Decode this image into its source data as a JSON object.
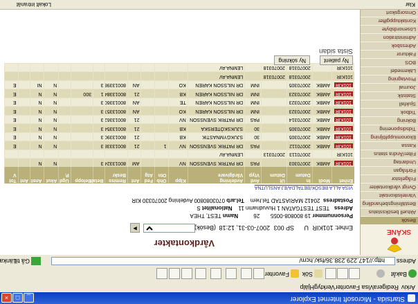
{
  "window": {
    "title": "Startsida - Microsoft Internet Explorer",
    "minimize": "_",
    "maximize": "□",
    "close": "×"
  },
  "menu": [
    "Arkiv",
    "Redigera",
    "Visa",
    "Favoriter",
    "Verktyg",
    "Hjälp"
  ],
  "toolbar": {
    "back": "Bakåt",
    "search": "Sök",
    "favorites": "Favoriter"
  },
  "address": {
    "label": "Adress",
    "url": "http://147.229.238.36/fsk/.hcm/",
    "go": "Gå till",
    "links": "Länkar"
  },
  "status": {
    "done": "Klar",
    "zone": "Lokalt intranät"
  },
  "sidebar": {
    "logo_text": "SKÅNE",
    "items": [
      {
        "label": "Besök",
        "active": true
      },
      {
        "label": "Aktuell besöksstatus",
        "active": false
      },
      {
        "label": "Beställningsbehandling",
        "active": false
      },
      {
        "label": "Väntelistkontakt",
        "active": false
      },
      {
        "label": "Övrigt vårdkontakter",
        "active": false
      },
      {
        "label": "Frågelistor",
        "active": false
      },
      {
        "label": "Förfrågan",
        "active": false
      },
      {
        "label": "Undantag",
        "active": false
      },
      {
        "label": "Filter/Ändra status",
        "active": false
      },
      {
        "label": "Kassa",
        "active": false
      },
      {
        "label": "Ekonomiuppföljning",
        "active": false
      },
      {
        "label": "Tidsdisponering",
        "active": false
      },
      {
        "label": "Bokning",
        "active": false
      },
      {
        "label": "Tidbok",
        "active": false
      },
      {
        "label": "Sjukfall",
        "active": false
      },
      {
        "label": "Statistik",
        "active": false
      },
      {
        "label": "Journal",
        "active": false
      },
      {
        "label": "Provtagning",
        "active": false
      },
      {
        "label": "Läkemedel",
        "active": false
      },
      {
        "label": "BOS",
        "active": false
      },
      {
        "label": "Fakturor",
        "active": false
      },
      {
        "label": "Adressbok",
        "active": false
      },
      {
        "label": "Administration",
        "active": false
      },
      {
        "label": "Lösenordsbyte",
        "active": false
      },
      {
        "label": "Kontaktuppgifter",
        "active": false
      },
      {
        "label": "Omsorgskort",
        "active": false
      }
    ]
  },
  "main": {
    "title": "Vårdkontakter",
    "meta": {
      "enhet": "Enhet: 101KIR",
      "u": "U",
      "sp": "SP 003",
      "datetime": "2007-03-31, 12:18",
      "reason_label": "(Besök)",
      "reason_value": ""
    },
    "patient": {
      "pnr_label": "Personnummer",
      "pnr": "19 800808-0055",
      "age": "26",
      "name_label": "Namn",
      "name": "TEST, THEA",
      "addr_label": "Adress",
      "addr": "TEST TESTGATAN 1   Huvudnamn 11",
      "nat_label": "Nationalitet",
      "nat": "S",
      "post_label": "Postadress",
      "post": "20412 MARIASTAD Tel.hem",
      "tel_label": "Tel.arb",
      "tel": "0703080800 Avdelning 20070330 KIR"
    },
    "show_all_link": "VISA ALLA BESÖK/BETALDA/EJ ANSLUTNA",
    "tabs": [
      "Ny patient",
      "Ny sökning"
    ],
    "section": "Sista sidan",
    "table": {
      "headers": [
        "Enhet",
        "Modt",
        "In\nDatum",
        "Ut\nDatum",
        "Avd\nVtyp",
        "Avdelning\nVårdgivare",
        "Klpp",
        "Ohb\nOtn",
        "Fed\nAtg",
        "Ant",
        "Remiss\nBeskr",
        "Betalt",
        "Belopp",
        "Ugd\nP.",
        "Akut",
        "Anst",
        "Ant",
        "Tot\nV"
      ],
      "rows": [
        [
          "101KIR",
          "AMBK",
          "20070303",
          "",
          "PAS",
          "DR PATRIK SVENSSON",
          "NV",
          "",
          "",
          "AM",
          "80013324",
          "3",
          "",
          "",
          "N",
          "N",
          "",
          ""
        ],
        [
          "101KIR",
          "",
          "20070113",
          "20070313",
          "",
          "LEMNA AV",
          "",
          "",
          "",
          "",
          "",
          "",
          "",
          "",
          "",
          "",
          "",
          ""
        ],
        [
          "101KIR",
          "AMBK",
          "20070112",
          "",
          "PAS",
          "DR PATRIK SVENSSON",
          "NV",
          "1",
          "",
          "21",
          "80013338",
          "3",
          "",
          "",
          "N",
          "N",
          "",
          "E"
        ],
        [
          "101KIR",
          "AMBK",
          "20070305",
          "",
          "30",
          "SJUKGYMNASTIK",
          "KB",
          "",
          "",
          "21",
          "80013390",
          "3",
          "",
          "",
          "N",
          "N",
          "",
          "E"
        ],
        [
          "101KIR",
          "AMBK",
          "20070305",
          "",
          "30",
          "SJUKSKÖTERSKA",
          "KB",
          "",
          "",
          "21",
          "80013354",
          "3",
          "",
          "",
          "N",
          "N",
          "",
          "E"
        ],
        [
          "101KIR",
          "AMBK",
          "20070314",
          "",
          "PAS",
          "DR PATRIK SVENSSON",
          "NV",
          "",
          "",
          "21",
          "80013362",
          "3",
          "",
          "",
          "N",
          "N",
          "",
          "E"
        ],
        [
          "101KIR",
          "AMBK",
          "20070323",
          "",
          "INM",
          "DR NILSSON KAREN",
          "KO",
          "",
          "",
          "AN",
          "80013357",
          "3",
          "",
          "",
          "N",
          "N",
          "",
          "E"
        ],
        [
          "101KIR",
          "AMBK",
          "20070323",
          "",
          "INM",
          "DR NILSSON KAREN",
          "TE",
          "",
          "",
          "AN",
          "80013360",
          "3",
          "",
          "",
          "N",
          "N",
          "",
          "E"
        ],
        [
          "101KIR",
          "AMBK",
          "20070323",
          "",
          "INM",
          "DR NILSSON KAREN",
          "KB",
          "",
          "",
          "21",
          "80013384",
          "1",
          "300",
          "",
          "N",
          "N",
          "",
          "E"
        ],
        [
          "101KIR",
          "AMBK",
          "20070305",
          "",
          "INM",
          "DR NILSSON KAREN",
          "KO",
          "",
          "",
          "AN",
          "80013398",
          "3",
          "",
          "",
          "N",
          "NI",
          "",
          "E"
        ],
        [
          "101KIR",
          "",
          "20070318",
          "20070318",
          "",
          "LEMNA AV",
          "",
          "",
          "",
          "",
          "",
          "",
          "",
          "",
          "",
          "",
          "",
          ""
        ],
        [
          "101KIR",
          "",
          "20070318",
          "20070318",
          "",
          "LEMNA AV",
          "",
          "",
          "",
          "",
          "",
          "",
          "",
          "",
          "",
          "",
          "",
          ""
        ]
      ],
      "highlight_rows": [
        0,
        2,
        3,
        4,
        5,
        6,
        7,
        8,
        9
      ]
    }
  }
}
